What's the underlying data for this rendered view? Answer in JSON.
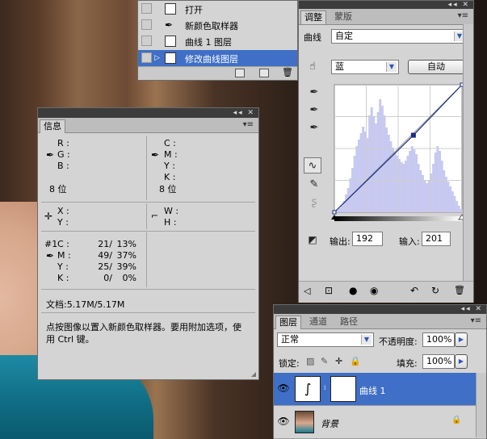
{
  "history": {
    "items": [
      {
        "label": "打开",
        "selected": false
      },
      {
        "label": "新颜色取样器",
        "selected": false
      },
      {
        "label": "曲线 1 图层",
        "selected": false
      },
      {
        "label": "修改曲线图层",
        "selected": true
      }
    ]
  },
  "info": {
    "tab": "信息",
    "rgb_labels": [
      "R :",
      "G :",
      "B :"
    ],
    "cmyk_labels": [
      "C :",
      "M :",
      "Y :",
      "K :"
    ],
    "bit_left": "8 位",
    "bit_right": "8 位",
    "xy_labels": [
      "X :",
      "Y :"
    ],
    "wh_labels": [
      "W :",
      "H :"
    ],
    "sampler_id": "#1",
    "sampler_rows": [
      {
        "ch": "C :",
        "v1": "21/",
        "v2": "13%"
      },
      {
        "ch": "M :",
        "v1": "49/",
        "v2": "37%"
      },
      {
        "ch": "Y :",
        "v1": "25/",
        "v2": "39%"
      },
      {
        "ch": "K :",
        "v1": "0/",
        "v2": "0%"
      }
    ],
    "doc": "文档:5.17M/5.17M",
    "hint": "点按图像以置入新颜色取样器。要用附加选项，使用 Ctrl 键。"
  },
  "adjust": {
    "tabs": [
      "调整",
      "蒙版"
    ],
    "preset_label": "曲线",
    "preset_value": "自定",
    "channel": "蓝",
    "auto_button": "自动",
    "output_label": "输出:",
    "output_value": "192",
    "input_label": "输入:",
    "input_value": "201",
    "curve_points": [
      [
        0,
        0
      ],
      [
        158,
        154
      ],
      [
        255,
        255
      ]
    ],
    "colors": {
      "curve": "#1b2c84",
      "histogram": "#c7c9f0"
    }
  },
  "layers": {
    "tabs": [
      "图层",
      "通道",
      "路径"
    ],
    "blend_mode": "正常",
    "opacity_label": "不透明度:",
    "opacity_value": "100%",
    "lock_label": "锁定:",
    "fill_label": "填充:",
    "fill_value": "100%",
    "rows": [
      {
        "name": "曲线 1",
        "selected": true
      },
      {
        "name": "背景",
        "selected": false
      }
    ]
  }
}
